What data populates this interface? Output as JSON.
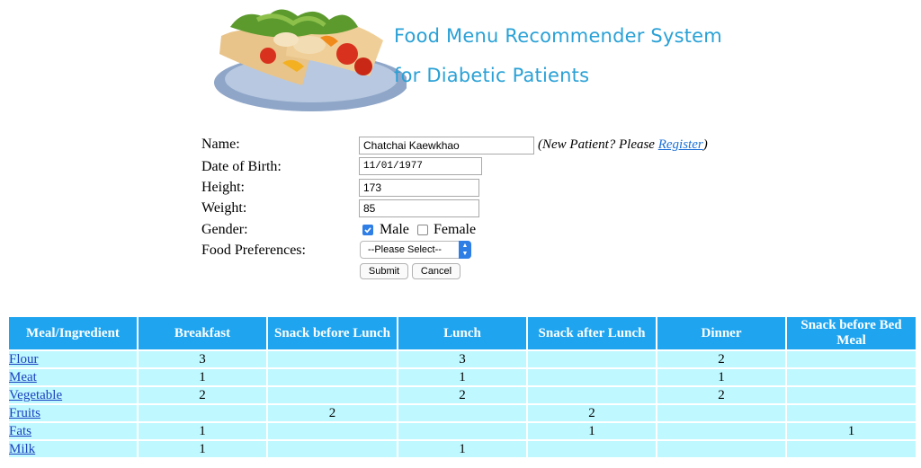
{
  "header": {
    "title_line1": "Food Menu Recommender System",
    "title_line2": "for Diabetic Patients",
    "accent_color": "#2aa1d6"
  },
  "form": {
    "name_label": "Name:",
    "name_value": "Chatchai Kaewkhao",
    "new_patient_prefix": "(New Patient? Please ",
    "register_link": "Register",
    "new_patient_suffix": ")",
    "dob_label": "Date of Birth:",
    "dob_value": "11/01/1977",
    "height_label": "Height:",
    "height_value": "173",
    "weight_label": "Weight:",
    "weight_value": "85",
    "gender_label": "Gender:",
    "gender_male": "Male",
    "gender_female": "Female",
    "male_checked": true,
    "female_checked": false,
    "pref_label": "Food Preferences:",
    "pref_selected": "--Please Select--",
    "submit_label": "Submit",
    "cancel_label": "Cancel"
  },
  "table": {
    "header_color": "#1fa5ef",
    "cell_color": "#bff8ff",
    "headers": [
      "Meal/Ingredient",
      "Breakfast",
      "Snack before Lunch",
      "Lunch",
      "Snack after Lunch",
      "Dinner",
      "Snack before Bed Meal"
    ],
    "rows": [
      {
        "ingredient": "Flour",
        "values": [
          "3",
          "",
          "3",
          "",
          "2",
          ""
        ]
      },
      {
        "ingredient": "Meat",
        "values": [
          "1",
          "",
          "1",
          "",
          "1",
          ""
        ]
      },
      {
        "ingredient": "Vegetable",
        "values": [
          "2",
          "",
          "2",
          "",
          "2",
          ""
        ]
      },
      {
        "ingredient": "Fruits",
        "values": [
          "",
          "2",
          "",
          "2",
          "",
          ""
        ]
      },
      {
        "ingredient": "Fats",
        "values": [
          "1",
          "",
          "",
          "1",
          "",
          "1"
        ]
      },
      {
        "ingredient": "Milk",
        "values": [
          "1",
          "",
          "1",
          "",
          "",
          ""
        ]
      }
    ]
  }
}
